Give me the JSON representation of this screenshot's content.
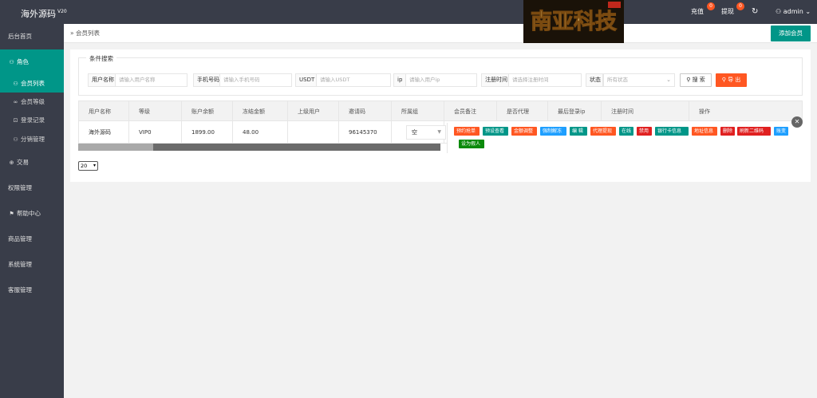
{
  "app": {
    "title": "海外源码",
    "version": "V20",
    "brand_logo_text": "南亚科技"
  },
  "topbar": {
    "recharge_label": "充值",
    "recharge_count": "0",
    "withdraw_label": "提现",
    "withdraw_count": "0",
    "refresh_icon": "refresh-icon",
    "user_label": "admin"
  },
  "sidebar": {
    "items": [
      {
        "label": "后台首页",
        "icon": ""
      },
      {
        "label": "角色",
        "icon": "user-icon"
      },
      {
        "label": "会员列表",
        "icon": "user-icon"
      },
      {
        "label": "会员等级",
        "icon": "link-icon"
      },
      {
        "label": "登录记录",
        "icon": "lock-icon"
      },
      {
        "label": "分销管理",
        "icon": "user-group-icon"
      },
      {
        "label": "交易",
        "icon": "cart-icon"
      },
      {
        "label": "权限管理",
        "icon": ""
      },
      {
        "label": "帮助中心",
        "icon": "flag-icon"
      },
      {
        "label": "商品管理",
        "icon": ""
      },
      {
        "label": "系统管理",
        "icon": ""
      },
      {
        "label": "客服管理",
        "icon": ""
      }
    ]
  },
  "breadcrumb": {
    "separator": "»",
    "current": "会员列表"
  },
  "add_member_label": "添加会员",
  "search": {
    "legend": "条件搜索",
    "username_label": "用户名称",
    "username_placeholder": "请输入用户名称",
    "phone_label": "手机号码",
    "phone_placeholder": "请输入手机号码",
    "usdt_label": "USDT",
    "usdt_placeholder": "请输入USDT",
    "ip_label": "ip",
    "ip_placeholder": "请输入用户ip",
    "regtime_label": "注册时间",
    "regtime_placeholder": "请选择注册时间",
    "status_label": "状态",
    "status_value": "所有状态",
    "search_button": "搜 索",
    "export_button": "导 出"
  },
  "table": {
    "columns": [
      "用户名称",
      "等级",
      "账户余额",
      "冻结金额",
      "上级用户",
      "邀请码",
      "所属组",
      "会员备注",
      "是否代理",
      "最后登录ip",
      "注册时间",
      "操作"
    ],
    "rows": [
      {
        "username": "海外源码",
        "level": "VIP0",
        "balance": "1899.00",
        "frozen": "48.00",
        "parent": "",
        "invite_code": "96145370",
        "group": "空"
      }
    ],
    "operations": [
      {
        "label": "预约抢单",
        "color": "#ff5722"
      },
      {
        "label": "预设查看",
        "color": "#009688"
      },
      {
        "label": "金额调整",
        "color": "#ff5722"
      },
      {
        "label": "强制解冻",
        "color": "#1e9fff"
      },
      {
        "label": "编 辑",
        "color": "#009688"
      },
      {
        "label": "代理提现",
        "color": "#ff5722"
      },
      {
        "label": "在线",
        "color": "#009688"
      },
      {
        "label": "禁用",
        "color": "#e02020"
      },
      {
        "label": "银行卡信息",
        "color": "#009688"
      },
      {
        "label": "地址信息",
        "color": "#ff5722"
      },
      {
        "label": "删除",
        "color": "#e02020"
      },
      {
        "label": "刷新二维码",
        "color": "#e02020"
      },
      {
        "label": "账变",
        "color": "#1e9fff"
      },
      {
        "label": "设为假人",
        "color": "#0a8a0a"
      }
    ]
  },
  "pagination": {
    "page_size": "20"
  }
}
